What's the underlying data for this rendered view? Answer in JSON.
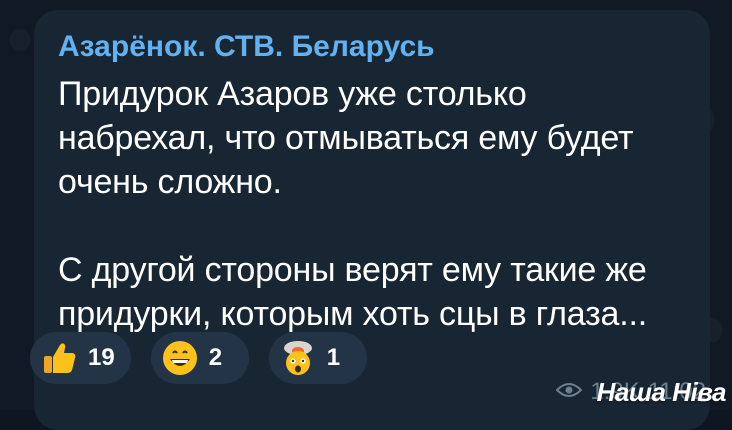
{
  "message": {
    "sender": "Азарёнок. СТВ. Беларусь",
    "text": "Придурок Азаров уже столько\nнабрехал, что отмываться ему будет\nочень сложно.\n\nС другой стороны верят ему такие же\nпридурки, которым хоть сцы в глаза...",
    "views": "1.9K",
    "time": "11:02"
  },
  "reactions": [
    {
      "icon": "thumbs-up-icon",
      "count": "19"
    },
    {
      "icon": "grinning-face-icon",
      "count": "2"
    },
    {
      "icon": "exploding-head-icon",
      "count": "1"
    }
  ],
  "watermark": "Наша Ніва",
  "colors": {
    "background": "#0e1621",
    "bubble": "#182533",
    "sender": "#62b1f0",
    "text": "#ffffff",
    "reaction_bg": "#233446",
    "meta": "#6d7f8f"
  }
}
